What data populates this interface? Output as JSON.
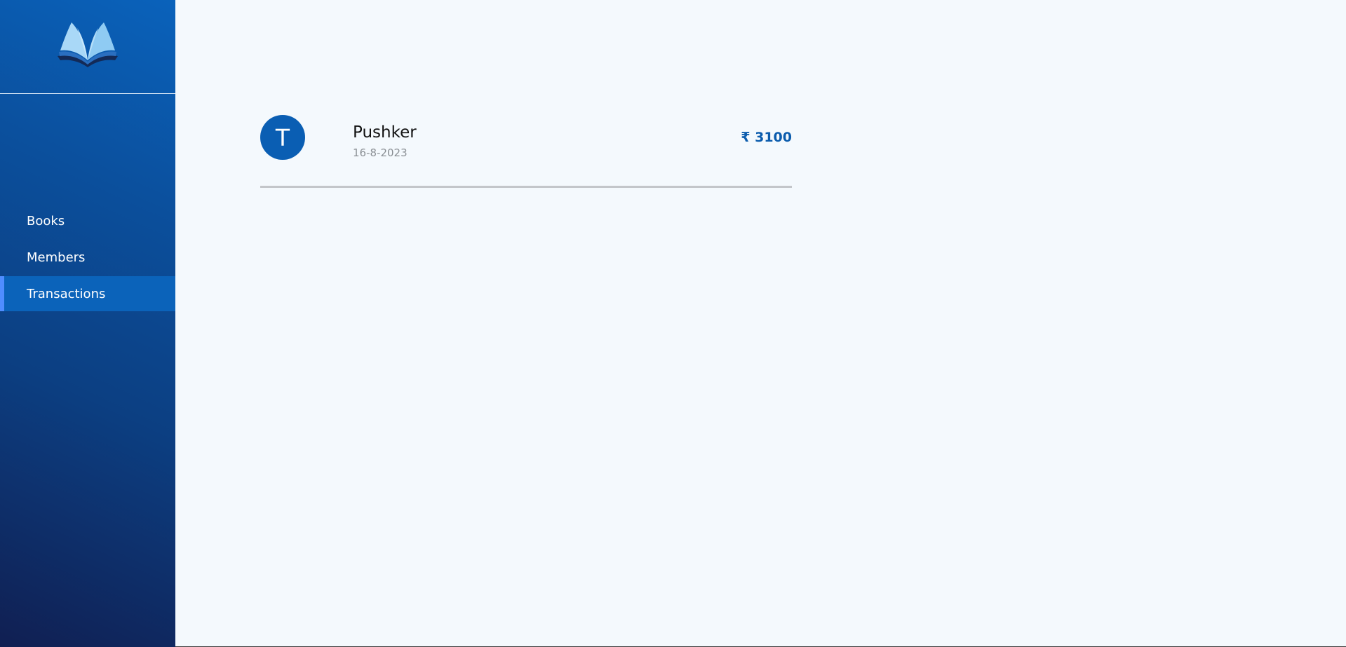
{
  "sidebar": {
    "logo_icon": "open-book-icon",
    "items": [
      {
        "label": "Books",
        "active": false
      },
      {
        "label": "Members",
        "active": false
      },
      {
        "label": "Transactions",
        "active": true
      }
    ]
  },
  "transactions": [
    {
      "avatar_letter": "T",
      "name": "Pushker",
      "date": "16-8-2023",
      "amount": "₹ 3100"
    }
  ],
  "colors": {
    "sidebar_gradient_top": "#0a62bb",
    "sidebar_gradient_bottom": "#101f52",
    "active_item_bg": "#0b63ba",
    "active_indicator": "#4f8dff",
    "accent": "#0a5eb3",
    "background": "#f4f9fd"
  }
}
